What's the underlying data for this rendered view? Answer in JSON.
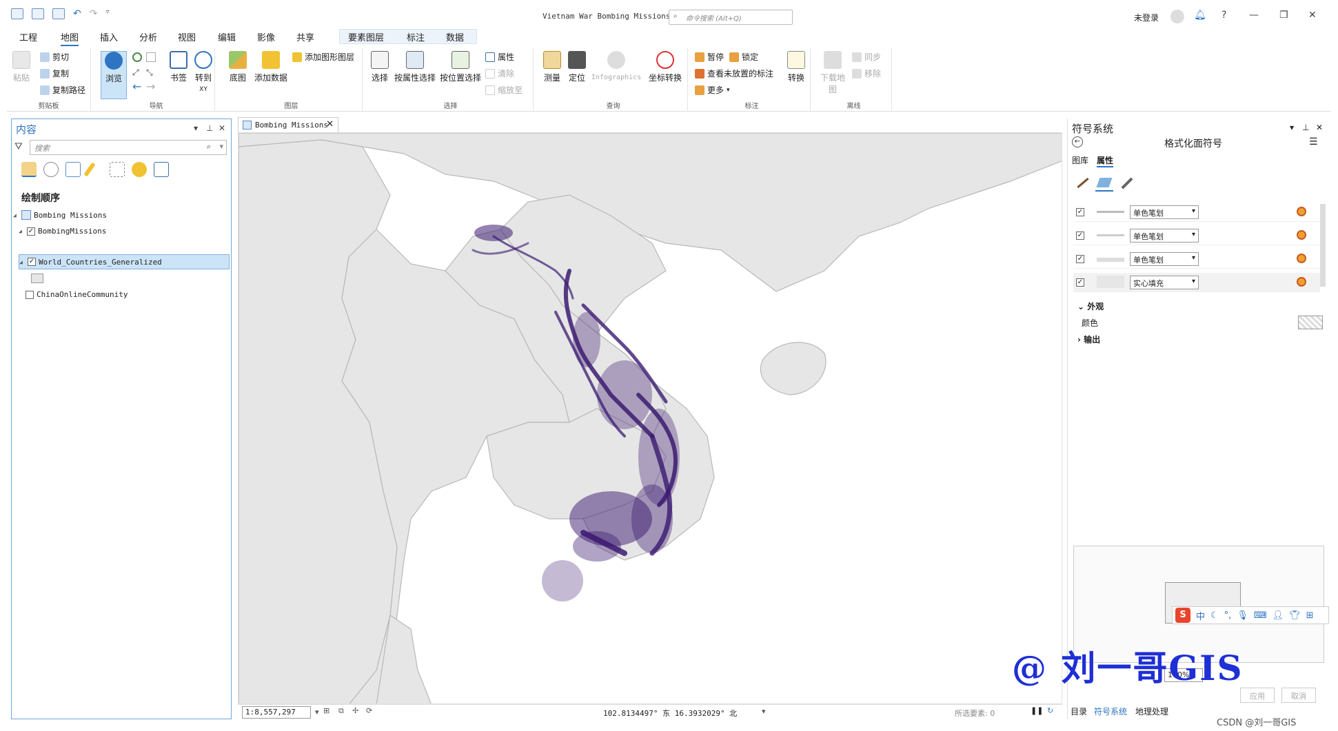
{
  "titlebar": {
    "doc_title": "Vietnam War Bombing Missions",
    "search_placeholder": "命令搜索 (Alt+Q)",
    "login": "未登录",
    "help": "?"
  },
  "ribbon_tabs": [
    "工程",
    "地图",
    "插入",
    "分析",
    "视图",
    "编辑",
    "影像",
    "共享",
    "要素图层",
    "标注",
    "数据"
  ],
  "ribbon": {
    "clipboard": {
      "label": "剪贴板",
      "paste": "粘贴",
      "cut": "剪切",
      "copy": "复制",
      "copy_path": "复制路径"
    },
    "navigate": {
      "label": "导航",
      "explore": "浏览",
      "bookmarks": "书签",
      "goto": "转到",
      "goto_sub": "XY"
    },
    "layer": {
      "label": "图层",
      "basemap": "底图",
      "add_data": "添加数据",
      "add_graphics": "添加图形图层"
    },
    "selection": {
      "label": "选择",
      "select": "选择",
      "by_attr": "按属性选择",
      "by_loc": "按位置选择",
      "attributes": "属性",
      "clear": "清除",
      "zoom_to": "缩放至"
    },
    "inquiry": {
      "label": "查询",
      "measure": "测量",
      "locate": "定位",
      "infographics": "Infographics",
      "coord": "坐标转换"
    },
    "labeling": {
      "label": "标注",
      "pause": "暂停",
      "lock": "锁定",
      "view_unplaced": "查看未放置的标注",
      "more": "更多",
      "convert": "转换"
    },
    "offline": {
      "label": "离线",
      "download": "下载地图",
      "sync": "同步",
      "remove": "移除"
    }
  },
  "contents": {
    "title": "内容",
    "search_placeholder": "搜索",
    "draw_order": "绘制顺序",
    "layers": [
      {
        "name": "Bombing Missions",
        "kind": "map"
      },
      {
        "name": "BombingMissions",
        "checked": true
      },
      {
        "name": "World_Countries_Generalized",
        "checked": true,
        "selected": true
      },
      {
        "name": "ChinaOnlineCommunity",
        "checked": false
      }
    ]
  },
  "map": {
    "tab": "Bombing Missions",
    "scale": "1:8,557,297",
    "coords": "102.8134497° 东 16.3932029° 北",
    "selected_count": "所选要素: 0"
  },
  "symbology": {
    "title": "符号系统",
    "subtitle": "格式化面符号",
    "tabs": [
      "图库",
      "属性"
    ],
    "layers": [
      {
        "label": "单色笔划",
        "checked": true
      },
      {
        "label": "单色笔划",
        "checked": true
      },
      {
        "label": "单色笔划",
        "checked": true
      },
      {
        "label": "实心填充",
        "checked": true
      }
    ],
    "appearance": "外观",
    "color": "颜色",
    "output": "输出",
    "zoom": "100%",
    "apply": "应用",
    "cancel": "取消",
    "bottom_tabs": [
      "目录",
      "符号系统",
      "地理处理"
    ]
  },
  "ime": {
    "lang": "中"
  },
  "watermark": "@ 刘一哥GIS",
  "credit": "CSDN @刘一哥GIS",
  "colors": {
    "accent": "#2e74c2",
    "bombing": "#3b1a70",
    "land": "#e6e6e6"
  }
}
